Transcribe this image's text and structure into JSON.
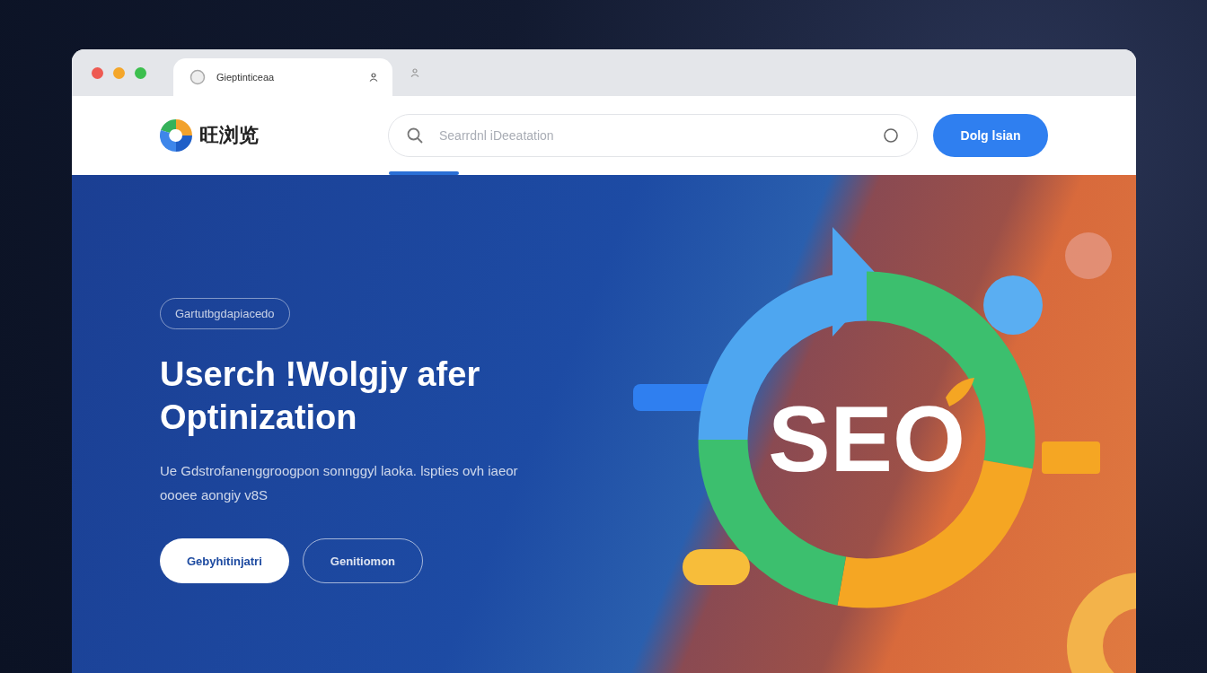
{
  "browser": {
    "window_controls": [
      {
        "color": "#ee5a52"
      },
      {
        "color": "#f4a62a"
      },
      {
        "color": "#3cbf4e"
      }
    ],
    "tab": {
      "title": "Gieptinticeaa"
    }
  },
  "toolbar": {
    "logo_text": "旺浏览",
    "search": {
      "placeholder": "Searrdnl iDeeatation"
    },
    "button": "Dolg lsian"
  },
  "hero": {
    "badge": "Gartutbgdapiacedo",
    "title_lines": [
      "Userch !Wolgjy afer",
      "Optinization"
    ],
    "description": "Ue Gdstrofanenggroogpon sonnggyl laoka. lspties ovh iaeor oooee aongiy v8S",
    "buttons": [
      {
        "label": "Gebyhitinjatri",
        "kind": "primary"
      },
      {
        "label": "Genitiomon",
        "kind": "outline"
      }
    ],
    "illustration_text": "SEO"
  }
}
